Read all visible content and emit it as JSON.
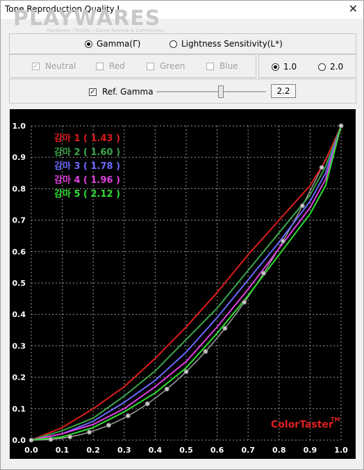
{
  "window": {
    "title": "Tone Reproduction Quality I",
    "close_glyph": "✕"
  },
  "watermark": {
    "brand": "PLAYWARES",
    "tagline": "Hardware / Mobile / Game Review & Community"
  },
  "mode": {
    "gamma_label": "Gamma(Γ)",
    "lightness_label": "Lightness Sensitivity(L*)",
    "selected": "gamma"
  },
  "channels": [
    {
      "label": "Neutral",
      "checked": true
    },
    {
      "label": "Red",
      "checked": false
    },
    {
      "label": "Green",
      "checked": false
    },
    {
      "label": "Blue",
      "checked": false
    }
  ],
  "scale": {
    "opt1": "1.0",
    "opt2": "2.0",
    "selected": "1.0"
  },
  "ref": {
    "label": "Ref. Gamma",
    "checked": true,
    "value": "2.2",
    "slider_fraction": 0.57
  },
  "colors": {
    "bg": "#000000",
    "grid": "#9a9a9a",
    "tick": "#ffffff",
    "ref_curve": "#a0a0a0",
    "brand": "#e02020"
  },
  "chart_data": {
    "type": "line",
    "xlim": [
      0,
      1
    ],
    "ylim": [
      0,
      1
    ],
    "x_ticks": [
      "0.0",
      "0.1",
      "0.2",
      "0.3",
      "0.4",
      "0.5",
      "0.6",
      "0.7",
      "0.8",
      "0.9",
      "1.0"
    ],
    "y_ticks": [
      "0.0",
      "0.1",
      "0.2",
      "0.3",
      "0.4",
      "0.5",
      "0.6",
      "0.7",
      "0.8",
      "0.9",
      "1.0"
    ],
    "grid": true,
    "legend_position": "top-left",
    "series": [
      {
        "name": "감마 1 ( 1.43 )",
        "color": "#dd1c1c",
        "x": [
          0,
          0.1,
          0.2,
          0.3,
          0.4,
          0.5,
          0.6,
          0.7,
          0.8,
          0.9,
          0.95,
          1
        ],
        "y": [
          0,
          0.04,
          0.1,
          0.17,
          0.26,
          0.36,
          0.47,
          0.59,
          0.7,
          0.81,
          0.89,
          1
        ]
      },
      {
        "name": "감마 2 ( 1.60 )",
        "color": "#3aa64a",
        "x": [
          0,
          0.1,
          0.2,
          0.3,
          0.4,
          0.5,
          0.6,
          0.7,
          0.8,
          0.9,
          0.95,
          1
        ],
        "y": [
          0,
          0.03,
          0.07,
          0.14,
          0.22,
          0.32,
          0.42,
          0.54,
          0.66,
          0.78,
          0.87,
          1
        ]
      },
      {
        "name": "감마 3 ( 1.78 )",
        "color": "#6a6aff",
        "x": [
          0,
          0.1,
          0.2,
          0.3,
          0.4,
          0.5,
          0.6,
          0.7,
          0.8,
          0.9,
          0.95,
          1
        ],
        "y": [
          0,
          0.02,
          0.06,
          0.12,
          0.19,
          0.28,
          0.39,
          0.51,
          0.63,
          0.76,
          0.85,
          1
        ]
      },
      {
        "name": "감마 4 ( 1.96 )",
        "color": "#e040e0",
        "x": [
          0,
          0.1,
          0.2,
          0.3,
          0.4,
          0.5,
          0.6,
          0.7,
          0.8,
          0.9,
          0.95,
          1
        ],
        "y": [
          0,
          0.02,
          0.05,
          0.1,
          0.17,
          0.25,
          0.36,
          0.48,
          0.61,
          0.74,
          0.83,
          1
        ]
      },
      {
        "name": "감마 5 ( 2.12 )",
        "color": "#30e030",
        "x": [
          0,
          0.1,
          0.2,
          0.3,
          0.4,
          0.5,
          0.6,
          0.7,
          0.8,
          0.9,
          0.95,
          1
        ],
        "y": [
          0,
          0.01,
          0.04,
          0.09,
          0.15,
          0.23,
          0.34,
          0.46,
          0.59,
          0.72,
          0.81,
          1
        ]
      }
    ],
    "reference": {
      "gamma": 2.2,
      "marker_x": [
        0,
        0.0625,
        0.125,
        0.1875,
        0.25,
        0.3125,
        0.375,
        0.4375,
        0.5,
        0.5625,
        0.625,
        0.6875,
        0.75,
        0.8125,
        0.875,
        0.9375,
        1
      ]
    },
    "brand_label": "ColorTaster",
    "brand_mark": "TM"
  }
}
